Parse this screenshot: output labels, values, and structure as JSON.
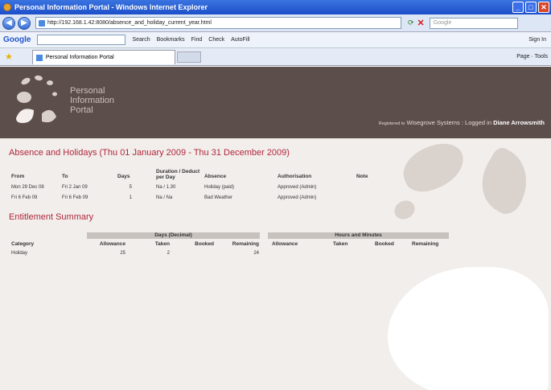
{
  "browser": {
    "title": "Personal Information Portal - Windows Internet Explorer",
    "url": "http://192.168.1.42:8080/absence_and_holiday_current_year.html",
    "search_placeholder": "Google",
    "toolbar": {
      "google": "Google",
      "search": "Search",
      "bookmarks": "Bookmarks",
      "find": "Find",
      "check": "Check",
      "autofill": "AutoFill",
      "signin": "Sign In"
    },
    "tab_label": "Personal Information Portal",
    "right_tools": {
      "page": "Page",
      "tools": "Tools"
    }
  },
  "portal": {
    "title_line1": "Personal",
    "title_line2": "Information",
    "title_line3": "Portal",
    "registered_prefix": "Registered to",
    "registered_company": "Wisegrove Systems : Logged in",
    "user": "Diane Arrowsmith"
  },
  "absence": {
    "heading": "Absence and Holidays (Thu 01 January 2009 - Thu 31 December 2009)",
    "cols": {
      "from": "From",
      "to": "To",
      "days": "Days",
      "duration_line1": "Duration / Deduct",
      "duration_line2": "per Day",
      "absence": "Absence",
      "authorisation": "Authorisation",
      "note": "Note"
    },
    "rows": [
      {
        "from": "Mon 29 Dec 08",
        "to": "Fri 2 Jan 09",
        "days": "5",
        "duration": "Na / 1.30",
        "absence": "Holiday (paid)",
        "authorisation": "Approved (Admin)",
        "note": ""
      },
      {
        "from": "Fri 6 Feb 09",
        "to": "Fri 6 Feb 09",
        "days": "1",
        "duration": "Na / Na",
        "absence": "Bad Weather",
        "authorisation": "Approved (Admin)",
        "note": ""
      }
    ]
  },
  "entitlement": {
    "heading": "Entitlement Summary",
    "band_days": "Days (Decimal)",
    "band_hours": "Hours and Minutes",
    "cols": {
      "category": "Category",
      "allowance": "Allowance",
      "taken": "Taken",
      "booked": "Booked",
      "remaining": "Remaining",
      "allowance2": "Allowance",
      "taken2": "Taken",
      "booked2": "Booked",
      "remaining2": "Remaining"
    },
    "rows": [
      {
        "category": "Holiday",
        "allowance": "25",
        "taken": "2",
        "booked": "",
        "remaining": "24"
      }
    ]
  },
  "colors": {
    "header": "#5c4e4a",
    "heading": "#b2273a",
    "content_bg": "#f1eeec"
  }
}
